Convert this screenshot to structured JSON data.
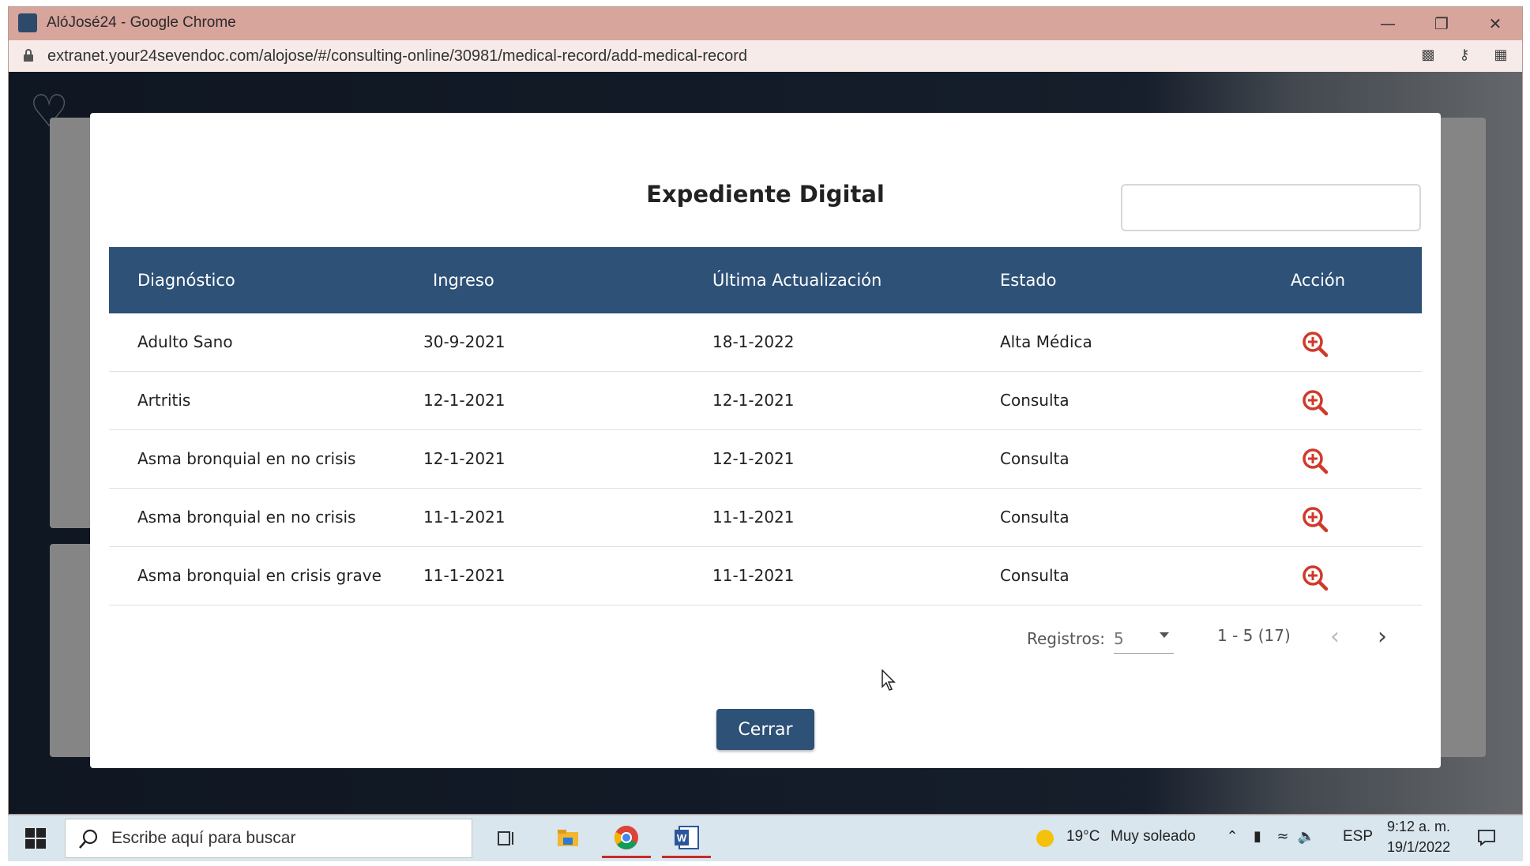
{
  "browser": {
    "window_title": "AlóJosé24 - Google Chrome",
    "url": "extranet.your24sevendoc.com/alojose/#/consulting-online/30981/medical-record/add-medical-record"
  },
  "modal": {
    "title": "Expediente Digital",
    "search_value": "",
    "columns": [
      "Diagnóstico",
      "Ingreso",
      "Última Actualización",
      "Estado",
      "Acción"
    ],
    "rows": [
      {
        "diagnostico": "Adulto Sano",
        "ingreso": "30-9-2021",
        "actualizacion": "18-1-2022",
        "estado": "Alta Médica",
        "accion_icon": "zoom-in-icon"
      },
      {
        "diagnostico": "Artritis",
        "ingreso": "12-1-2021",
        "actualizacion": "12-1-2021",
        "estado": "Consulta",
        "accion_icon": "zoom-in-icon"
      },
      {
        "diagnostico": "Asma bronquial en no crisis",
        "ingreso": "12-1-2021",
        "actualizacion": "12-1-2021",
        "estado": "Consulta",
        "accion_icon": "zoom-in-icon"
      },
      {
        "diagnostico": "Asma bronquial en no crisis",
        "ingreso": "11-1-2021",
        "actualizacion": "11-1-2021",
        "estado": "Consulta",
        "accion_icon": "zoom-in-icon"
      },
      {
        "diagnostico": "Asma bronquial en crisis grave",
        "ingreso": "11-1-2021",
        "actualizacion": "11-1-2021",
        "estado": "Consulta",
        "accion_icon": "zoom-in-icon"
      }
    ],
    "paginator": {
      "label": "Registros:",
      "page_size": "5",
      "range": "1 - 5 (17)"
    },
    "close_label": "Cerrar"
  },
  "taskbar": {
    "search_placeholder": "Escribe aquí para buscar",
    "temperature": "19°C",
    "weather": "Muy soleado",
    "language": "ESP",
    "time": "9:12 a. m.",
    "date": "19/1/2022"
  },
  "colors": {
    "header_bg": "#2e5177",
    "action_icon": "#d0392b",
    "title_bar": "#d7a59c"
  }
}
